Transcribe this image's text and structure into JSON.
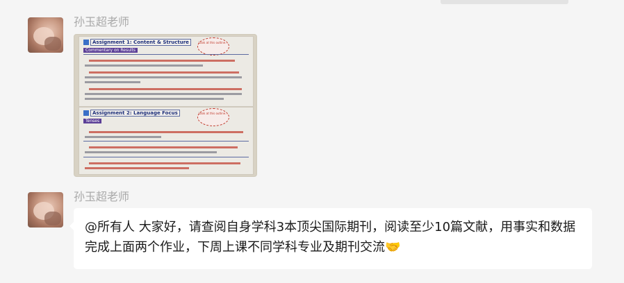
{
  "chat": {
    "messages": [
      {
        "sender": "孙玉超老师",
        "type": "image",
        "image": {
          "slides": [
            {
              "title": "Assignment 1: Content & Structure",
              "tag": "Commentary on Results",
              "note": "Look at this outline...",
              "points": [
                "The Introduction … the Results section should simply describe the reporting of the collected data",
                "A shorter answer … a detailed and extended commentary on the observations … with the Discussion section",
                "Did authors … in their Results section, the key … of the findings … the next section"
              ]
            },
            {
              "title": "Assignment 2: Language Focus",
              "tag": "Tenses",
              "note": "Look at this outline...",
              "points": [
                "The tense … used … present … in the results sections …",
                "When you report your findings … use the past tense …",
                "When … of your findings … use the present tense … or tentative verbs"
              ]
            }
          ]
        }
      },
      {
        "sender": "孙玉超老师",
        "type": "text",
        "text": "@所有人 大家好，请查阅自身学科3本顶尖国际期刊，阅读至少10篇文献，用事实和数据完成上面两个作业，下周上课不同学科专业及期刊交流",
        "emoji": "handshake-icon"
      }
    ]
  }
}
